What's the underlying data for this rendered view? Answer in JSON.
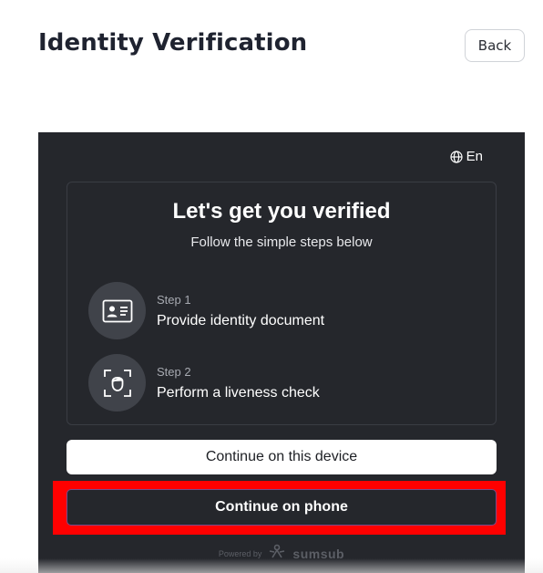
{
  "header": {
    "title": "Identity Verification",
    "back_label": "Back"
  },
  "widget": {
    "language": "En",
    "title": "Let's get you verified",
    "subtitle": "Follow the simple steps below",
    "steps": [
      {
        "label": "Step 1",
        "description": "Provide identity document",
        "icon": "id-card-icon"
      },
      {
        "label": "Step 2",
        "description": "Perform a liveness check",
        "icon": "face-scan-icon"
      }
    ],
    "continue_device_label": "Continue on this device",
    "continue_phone_label": "Continue on phone",
    "powered_by": "Powered by",
    "brand": "sumsub"
  },
  "colors": {
    "widget_bg": "#25272c",
    "highlight": "#ff0000"
  }
}
